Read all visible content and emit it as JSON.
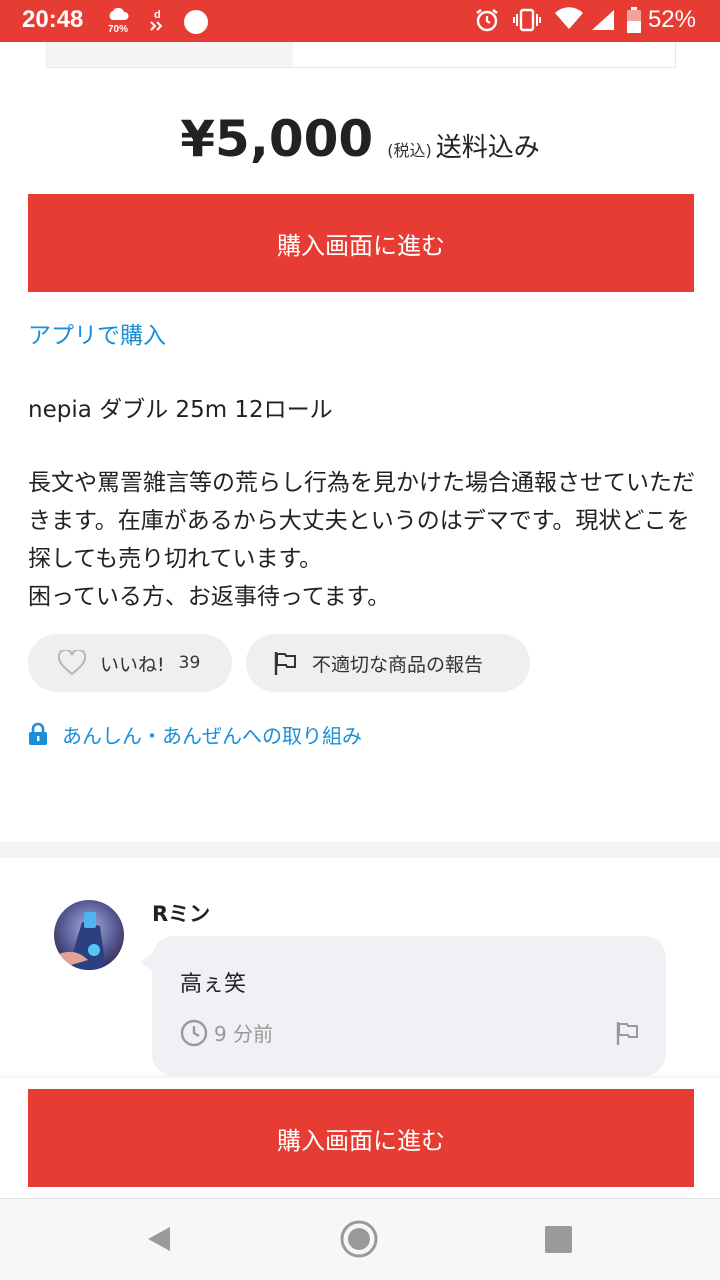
{
  "status_bar": {
    "time": "20:48",
    "weather_badge": "70%",
    "battery_percent": "52%",
    "background": "#e73c34"
  },
  "listing": {
    "price": "¥5,000",
    "tax_note": "(税込)",
    "shipping": "送料込み",
    "buy_button_label": "購入画面に進む",
    "app_link": "アプリで購入",
    "title": "nepia ダブル 25m 12ロール",
    "description": "長文や罵詈雑言等の荒らし行為を見かけた場合通報させていただきます。在庫があるから大丈夫というのはデマです。現状どこを探しても売り切れています。\n困っている方、お返事待ってます。"
  },
  "actions": {
    "like_label": "いいね!",
    "like_count": "39",
    "report_label": "不適切な商品の報告",
    "safety_link": "あんしん・あんぜんへの取り組み"
  },
  "comment": {
    "author": "Rミン",
    "text": "高ぇ笑",
    "time_ago": "9 分前"
  },
  "colors": {
    "accent": "#e73c34",
    "link": "#1a8fd8",
    "bubble": "#eff1f4"
  }
}
